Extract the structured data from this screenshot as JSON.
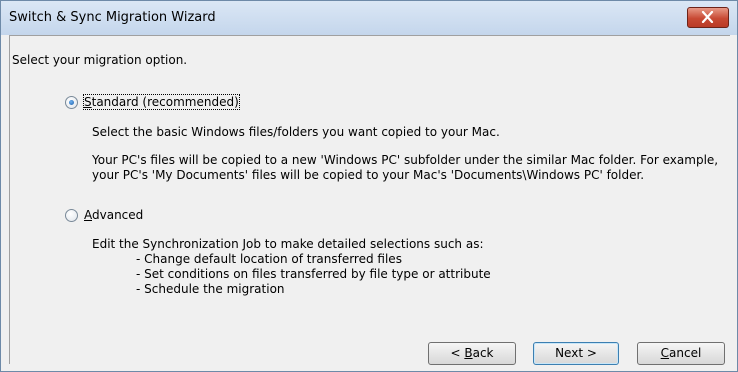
{
  "window": {
    "title": "Switch & Sync Migration Wizard"
  },
  "prompt": "Select your migration option.",
  "options": [
    {
      "label_access": "S",
      "label_rest": "tandard (recommended)",
      "selected": true,
      "descriptions": [
        "Select the basic Windows files/folders you want copied to your Mac.",
        "Your PC's files will be copied to a new 'Windows PC' subfolder under the similar Mac folder. For example, your PC's 'My Documents' files will be copied to your Mac's 'Documents\\Windows PC' folder."
      ]
    },
    {
      "label_access": "A",
      "label_rest": "dvanced",
      "selected": false,
      "descriptions": [
        "Edit the Synchronization Job to make detailed selections such as:"
      ],
      "bullets": [
        "- Change default location of transferred files",
        "- Set conditions on files transferred by file type or attribute",
        "- Schedule the migration"
      ]
    }
  ],
  "buttons": {
    "back_prefix": "< ",
    "back_access": "B",
    "back_rest": "ack",
    "next_label": "Next >",
    "cancel_access": "C",
    "cancel_rest": "ancel"
  }
}
